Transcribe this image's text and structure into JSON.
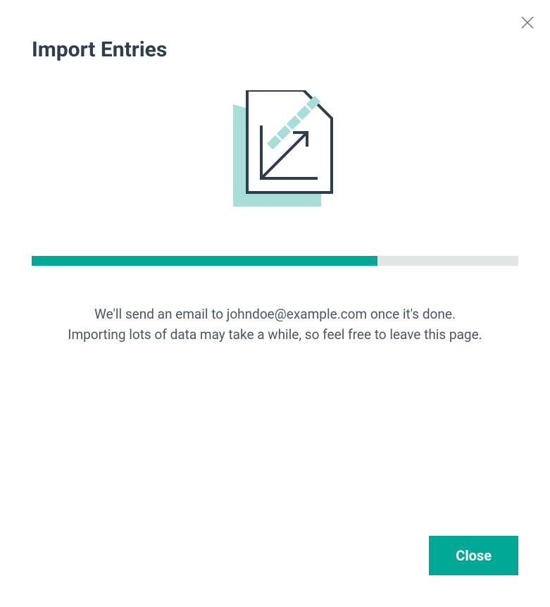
{
  "modal": {
    "title": "Import Entries",
    "message_line1": "We'll send an email to johndoe@example.com once it's done.",
    "message_line2": "Importing lots of data may take a while, so feel free to leave this page.",
    "close_button_label": "Close",
    "progress_percent": 71
  },
  "colors": {
    "accent": "#00A896",
    "accent_light": "#A8DED7",
    "text_dark": "#2C3E50",
    "text_body": "#4A5568",
    "progress_bg": "#E0E6E4"
  }
}
